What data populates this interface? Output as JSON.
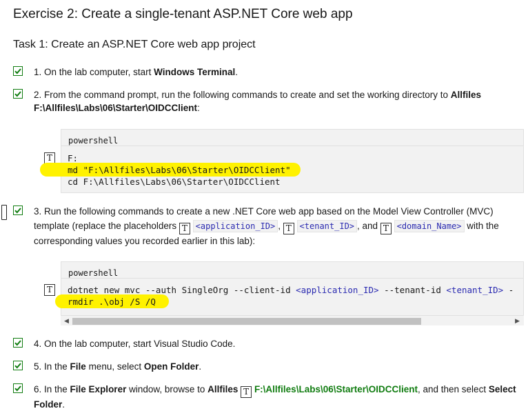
{
  "exercise_title": "Exercise 2: Create a single-tenant ASP.NET Core web app",
  "task_title": "Task 1: Create an ASP.NET Core web app project",
  "steps": [
    {
      "pre": "1. On the lab computer, start ",
      "bold": "Windows Terminal",
      "post": "."
    },
    {
      "pre": "2. From the command prompt, run the following commands to create and set the working directory to ",
      "bold": "Allfiles F:\\Allfiles\\Labs\\06\\Starter\\OIDCClient",
      "post": ":"
    },
    {
      "pre": "3. Run the following commands to create a new .NET Core web app based on the Model View Controller (MVC) template (replace the placeholders",
      "sep1": ",",
      "sep2": ", and",
      "post": "with the corresponding values you recorded earlier in this lab):"
    },
    {
      "text": "4. On the lab computer, start Visual Studio Code."
    },
    {
      "pre": "5. In the ",
      "bold": "File",
      "mid": " menu, select ",
      "bold2": "Open Folder",
      "post": "."
    },
    {
      "pre": "6. In the ",
      "bold": "File Explorer",
      "mid": " window, browse to ",
      "bold2": "Allfiles",
      "path": "F:\\Allfiles\\Labs\\06\\Starter\\OIDCClient",
      "post": ", and then select",
      "bold3": "Select Folder",
      "post2": "."
    }
  ],
  "placeholders": [
    "<application_ID>",
    "<tenant_ID>",
    "<domain_Name>"
  ],
  "type_icon": "T",
  "code_block_1": {
    "language": "powershell",
    "lines": [
      "F:",
      "md \"F:\\Allfiles\\Labs\\06\\Starter\\OIDCClient\"",
      "cd F:\\Allfiles\\Labs\\06\\Starter\\OIDCClient"
    ]
  },
  "code_block_2": {
    "language": "powershell",
    "line1_parts": [
      "dotnet new mvc --auth SingleOrg --client-id ",
      "<application_ID>",
      " --tenant-id ",
      "<tenant_ID>",
      " -"
    ],
    "line2": "rmdir .\\obj /S /Q"
  },
  "colors": {
    "highlight": "#fff200",
    "check": "#107c10",
    "code_bg": "#f2f2f2"
  }
}
